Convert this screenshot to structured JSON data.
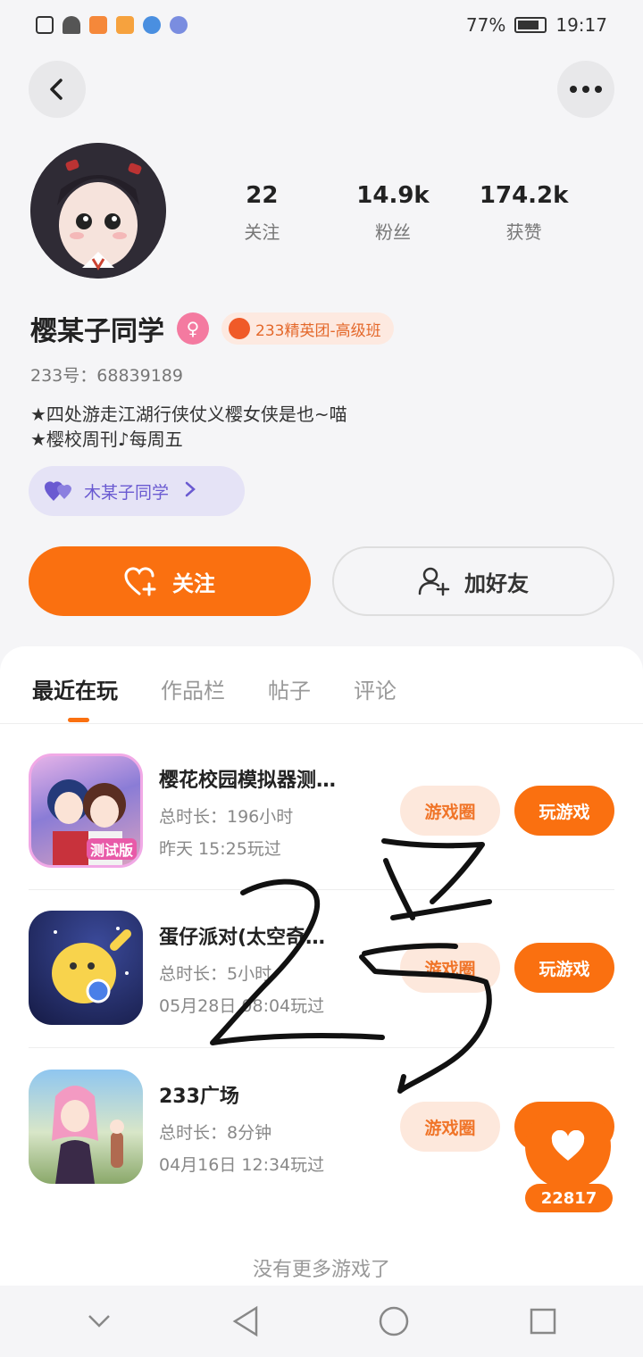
{
  "status_bar": {
    "battery": "77%",
    "time": "19:17"
  },
  "profile": {
    "name": "樱某子同学",
    "badge": "233精英团-高级班",
    "uid_label": "233号：",
    "uid": "68839189",
    "bio_line1": "★四处游走江湖行侠仗义樱女侠是也~喵",
    "bio_line2": "★樱校周刊♪每周五",
    "link_pill": "木某子同学"
  },
  "stats": [
    {
      "value": "22",
      "label": "关注"
    },
    {
      "value": "14.9k",
      "label": "粉丝"
    },
    {
      "value": "174.2k",
      "label": "获赞"
    }
  ],
  "actions": {
    "follow": "关注",
    "add_friend": "加好友"
  },
  "tabs": [
    "最近在玩",
    "作品栏",
    "帖子",
    "评论"
  ],
  "games": [
    {
      "title": "樱花校园模拟器测…",
      "duration": "总时长：196小时",
      "last_played": "昨天 15:25玩过",
      "circle_btn": "游戏圈",
      "play_btn": "玩游戏",
      "icon_badge": "测试版"
    },
    {
      "title": "蛋仔派对(太空奇…",
      "duration": "总时长：5小时",
      "last_played": "05月28日 08:04玩过",
      "circle_btn": "游戏圈",
      "play_btn": "玩游戏"
    },
    {
      "title": "233广场",
      "duration": "总时长：8分钟",
      "last_played": "04月16日 12:34玩过",
      "circle_btn": "游戏圈",
      "play_btn": "玩游戏"
    }
  ],
  "no_more": "没有更多游戏了",
  "like_count": "22817",
  "colors": {
    "accent": "#fa7010",
    "pill_bg": "#e5e3f6",
    "pill_text": "#6a5ad1"
  }
}
